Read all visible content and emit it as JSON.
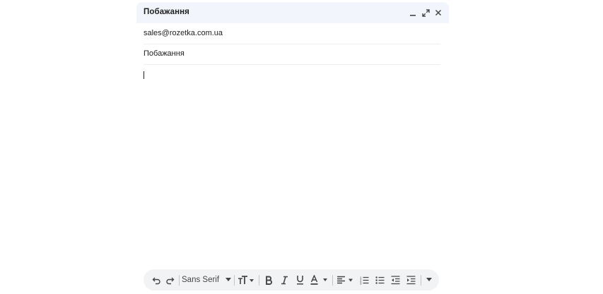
{
  "compose": {
    "title": "Побажання",
    "to": "sales@rozetka.com.ua",
    "subject": "Побажання",
    "body": ""
  },
  "toolbar": {
    "font_family": "Sans Serif"
  },
  "colors": {
    "header_bg": "#f2f6fc",
    "toolbar_bg": "#f1f3f4",
    "icon": "#444746",
    "text": "#1f1f1f"
  },
  "icons": {
    "header": [
      "minimize-icon",
      "expand-icon",
      "close-icon"
    ],
    "toolbar": [
      "undo-icon",
      "redo-icon",
      "font-family-dropdown",
      "font-size-icon",
      "bold-icon",
      "italic-icon",
      "underline-icon",
      "text-color-icon",
      "align-icon",
      "numbered-list-icon",
      "bulleted-list-icon",
      "indent-less-icon",
      "indent-more-icon",
      "more-formatting-icon"
    ]
  }
}
